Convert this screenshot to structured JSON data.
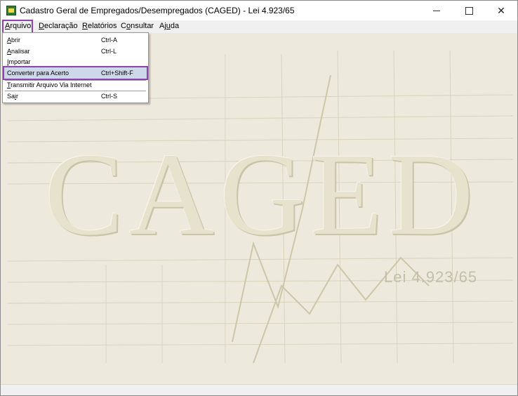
{
  "window": {
    "title": "Cadastro Geral de Empregados/Desempregados (CAGED) - Lei 4.923/65",
    "minimize": "—",
    "maximize": "☐",
    "close": "✕"
  },
  "menubar": {
    "arquivo": {
      "underline": "A",
      "rest": "rquivo"
    },
    "declaracao": {
      "underline": "D",
      "rest": "eclaração"
    },
    "relatorios": {
      "underline": "R",
      "rest": "elatórios"
    },
    "consultar": {
      "prefix": "C",
      "underline": "o",
      "rest": "nsultar"
    },
    "ajuda": {
      "prefix": "Aj",
      "underline": "u",
      "rest": "da"
    }
  },
  "arquivo_menu": [
    {
      "prefix": "",
      "underline": "A",
      "rest": "brir",
      "shortcut": "Ctrl-A",
      "highlighted": false
    },
    {
      "prefix": "",
      "underline": "A",
      "rest": "nalisar",
      "shortcut": "Ctrl-L",
      "highlighted": false
    },
    {
      "prefix": "",
      "underline": "I",
      "rest": "mportar",
      "shortcut": "",
      "highlighted": false
    },
    {
      "prefix": "",
      "underline": "",
      "rest": "Converter para Acerto",
      "shortcut": "Ctrl+Shift-F",
      "highlighted": true
    },
    {
      "prefix": "",
      "underline": "T",
      "rest": "ransmitir Arquivo Via Internet",
      "shortcut": "",
      "highlighted": false
    },
    {
      "prefix": "Sa",
      "underline": "i",
      "rest": "r",
      "shortcut": "Ctrl-S",
      "highlighted": false
    }
  ],
  "background": {
    "logo_text": "CAGED",
    "logo_subtitle": "Lei 4.923/65"
  },
  "colors": {
    "accent_outline": "#8e44ad",
    "highlight_bg": "#cfd8ea",
    "client_bg": "#ede9dd"
  },
  "icons": {
    "app": "caged-app-icon",
    "minimize": "minimize-icon",
    "maximize": "maximize-icon",
    "close": "close-icon"
  }
}
